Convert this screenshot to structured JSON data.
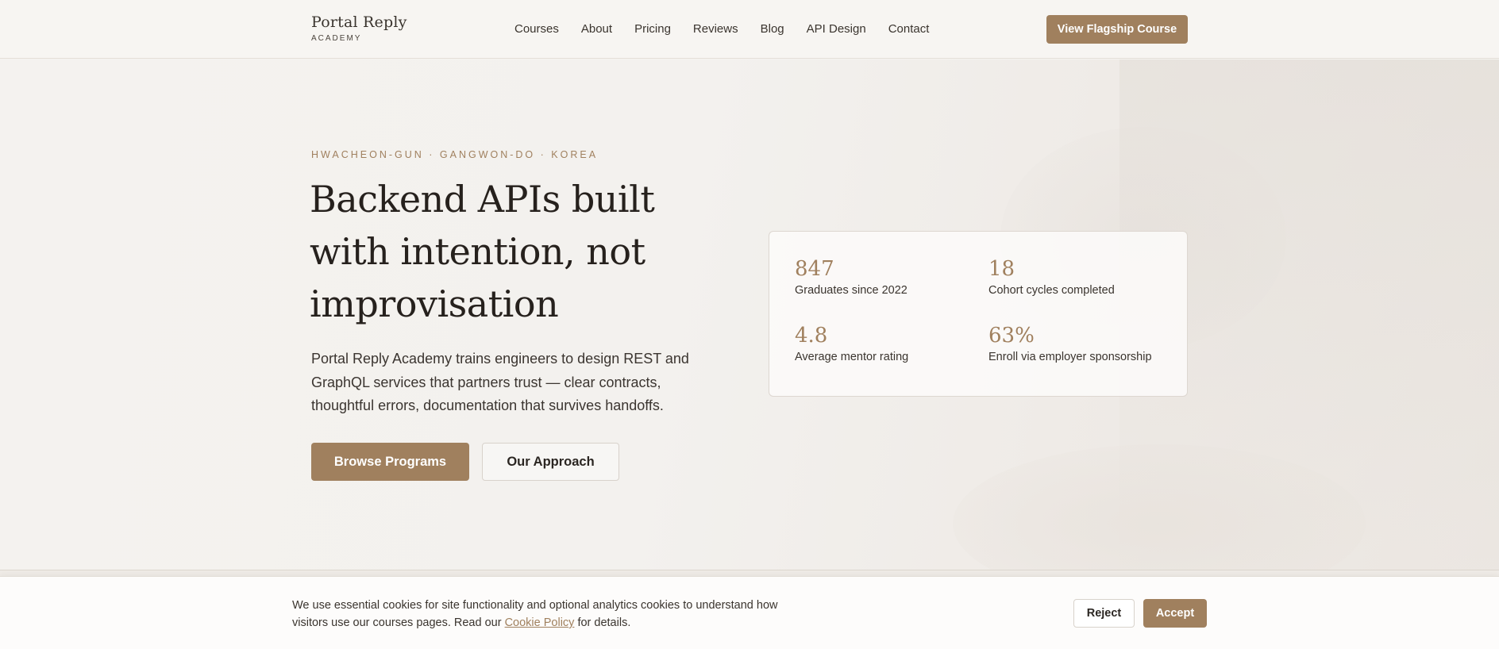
{
  "header": {
    "brand_name": "Portal Reply",
    "brand_sub": "ACADEMY",
    "nav": [
      {
        "label": "Courses"
      },
      {
        "label": "About"
      },
      {
        "label": "Pricing"
      },
      {
        "label": "Reviews"
      },
      {
        "label": "Blog"
      },
      {
        "label": "API Design"
      },
      {
        "label": "Contact"
      }
    ],
    "cta_label": "View Flagship Course"
  },
  "hero": {
    "eyebrow": "HWACHEON-GUN · GANGWON-DO · KOREA",
    "title": "Backend APIs built with intention, not improvisation",
    "description": "Portal Reply Academy trains engineers to design REST and GraphQL services that partners trust — clear contracts, thoughtful errors, documentation that survives handoffs.",
    "primary_button": "Browse Programs",
    "secondary_button": "Our Approach"
  },
  "stats": [
    {
      "value": "847",
      "label": "Graduates since 2022"
    },
    {
      "value": "18",
      "label": "Cohort cycles completed"
    },
    {
      "value": "4.8",
      "label": "Average mentor rating"
    },
    {
      "value": "63%",
      "label": "Enroll via employer sponsorship"
    }
  ],
  "cookie": {
    "text_before": "We use essential cookies for site functionality and optional analytics cookies to understand how visitors use our courses pages. Read our ",
    "link_label": "Cookie Policy",
    "text_after": " for details.",
    "reject_label": "Reject",
    "accept_label": "Accept"
  },
  "colors": {
    "accent": "#a0805e",
    "background": "#f5f3f0",
    "text": "#2b2622"
  }
}
